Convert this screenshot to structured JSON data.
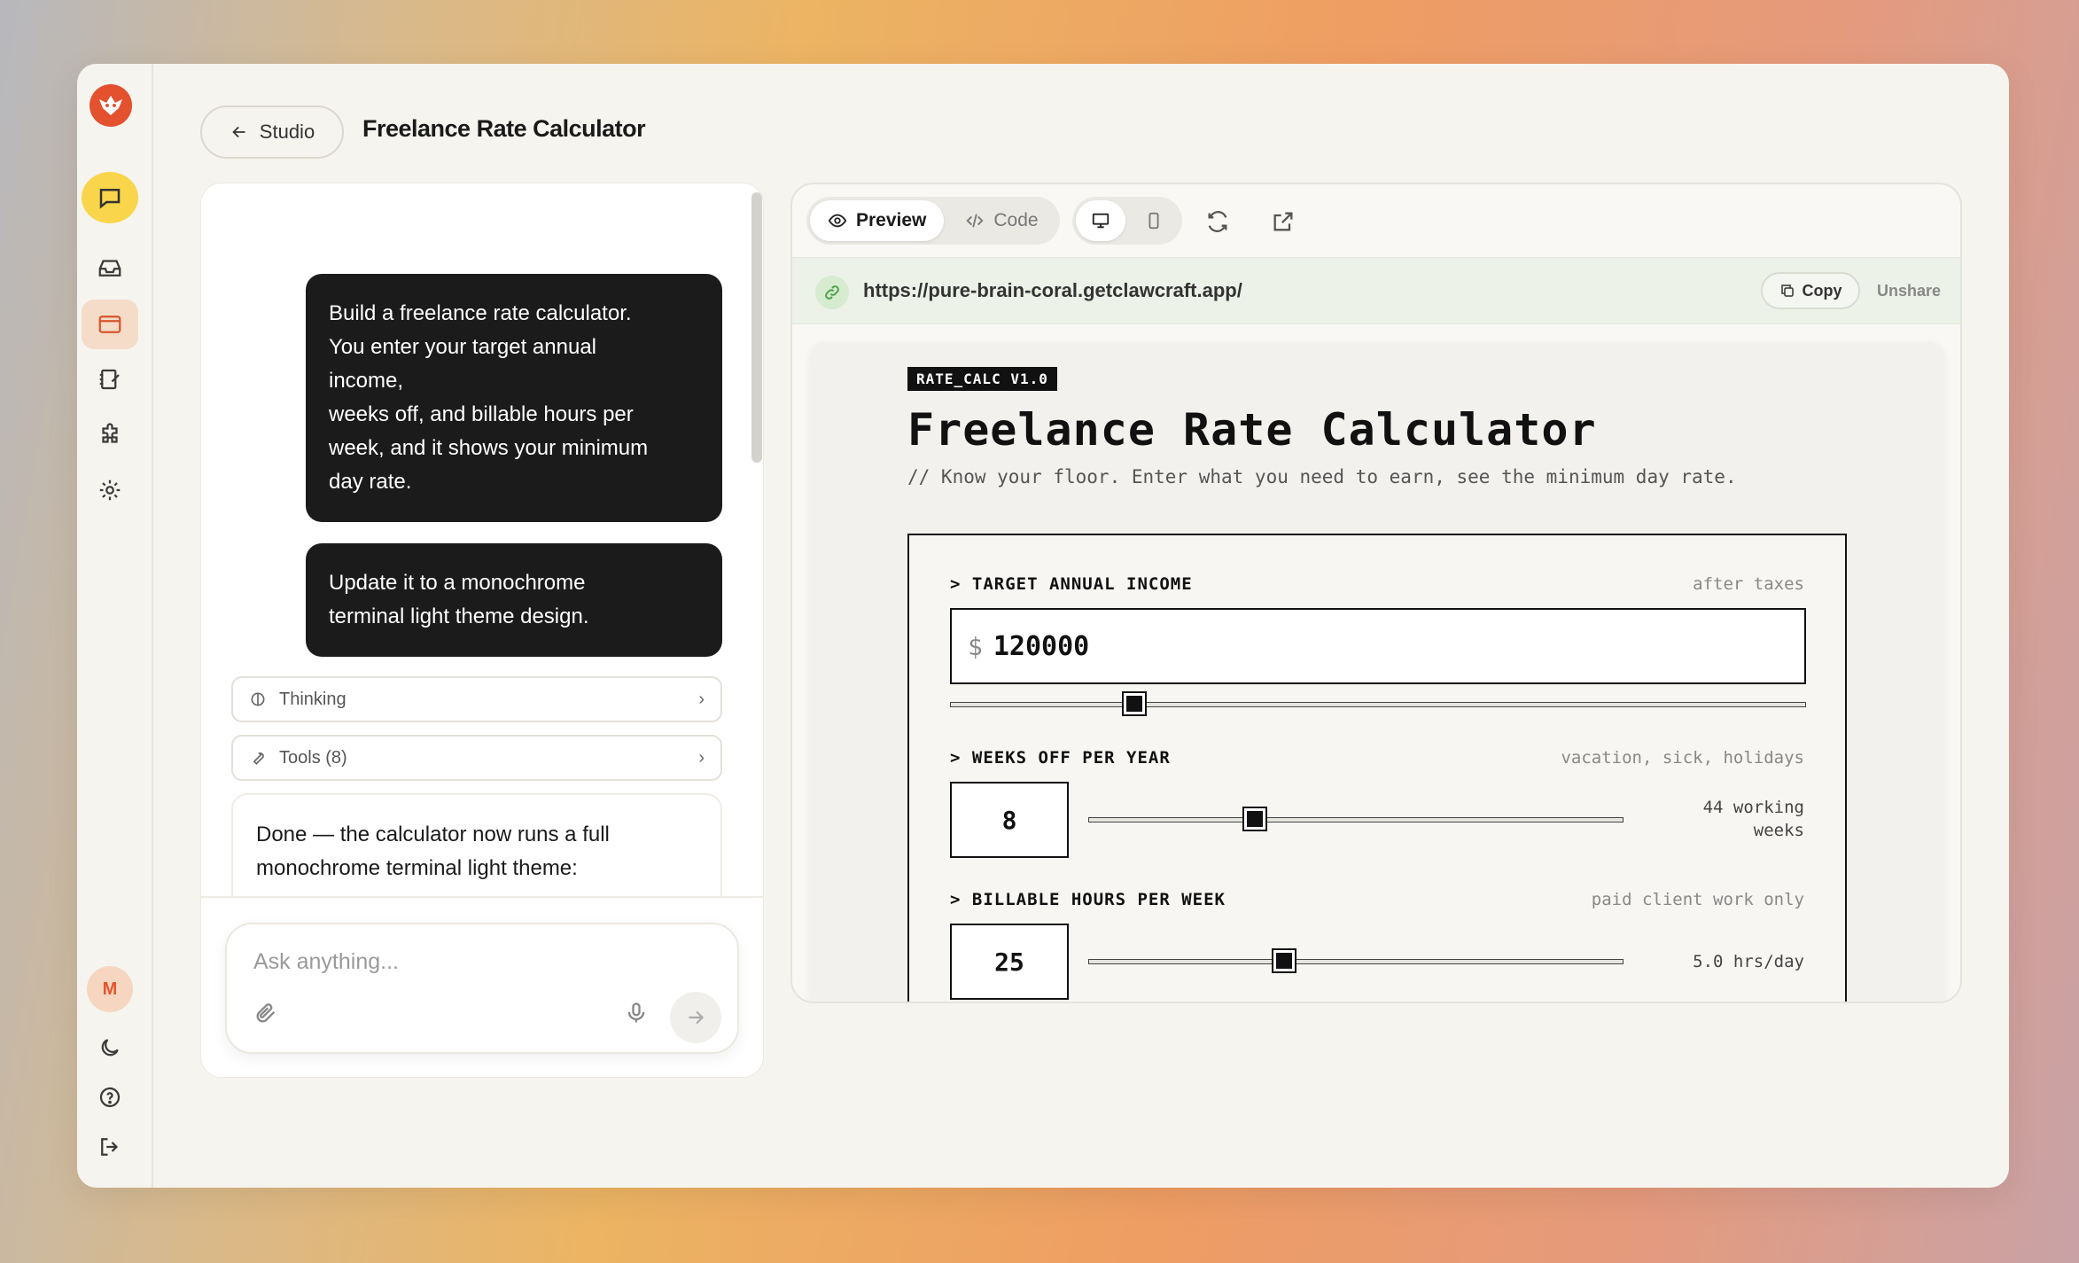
{
  "header": {
    "back_label": "Studio",
    "page_title": "Freelance Rate Calculator"
  },
  "chat": {
    "messages": [
      "Build a freelance rate calculator.\nYou enter your target annual\nincome,\nweeks off, and billable hours per\nweek, and it shows your minimum\nday rate.",
      "Update it to a monochrome\nterminal light theme design."
    ],
    "thinking_label": "Thinking",
    "tools_label": "Tools (8)",
    "reply": "Done — the calculator now runs a full monochrome terminal light theme:",
    "composer_placeholder": "Ask anything..."
  },
  "sidebar": {
    "avatar_initial": "M"
  },
  "preview": {
    "tabs": [
      "Preview",
      "Code"
    ],
    "url": "https://pure-brain-coral.getclawcraft.app/",
    "copy_label": "Copy",
    "unshare_label": "Unshare"
  },
  "app": {
    "badge": "RATE_CALC V1.0",
    "title": "Freelance Rate Calculator",
    "subtitle": "// Know your floor. Enter what you need to earn, see the minimum day rate.",
    "income": {
      "label": "> TARGET ANNUAL INCOME",
      "hint": "after taxes",
      "currency": "$",
      "value": "120000",
      "slider_fraction": 0.215
    },
    "weeks_off": {
      "label": "> WEEKS OFF PER YEAR",
      "hint": "vacation, sick, holidays",
      "value": "8",
      "note_line1": "44 working",
      "note_line2": "weeks",
      "slider_fraction": 0.31
    },
    "hours": {
      "label": "> BILLABLE HOURS PER WEEK",
      "hint": "paid client work only",
      "value": "25",
      "note": "5.0 hrs/day",
      "slider_fraction": 0.365
    }
  },
  "colors": {
    "accent": "#e3512f",
    "chat_active": "#f8d54a",
    "bubble": "#1b1b1b"
  }
}
